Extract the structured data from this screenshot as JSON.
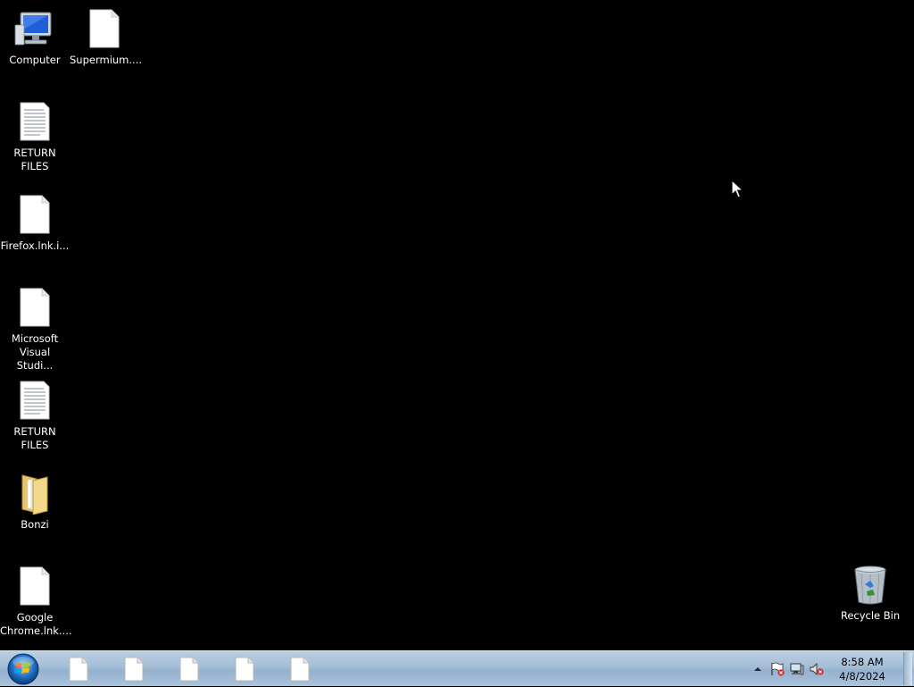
{
  "desktop": {
    "icons": [
      {
        "label": "Computer",
        "icon": "computer-icon"
      },
      {
        "label": "Supermium....",
        "icon": "file-icon"
      },
      {
        "label": "RETURN FILES",
        "icon": "text-document-icon"
      },
      {
        "label": "Firefox.lnk.i...",
        "icon": "file-icon"
      },
      {
        "label": "Microsoft\nVisual Studi...",
        "icon": "file-icon"
      },
      {
        "label": "RETURN FILES",
        "icon": "text-document-icon"
      },
      {
        "label": "Bonzi",
        "icon": "folder-icon"
      },
      {
        "label": "Google\nChrome.lnk....",
        "icon": "file-icon"
      },
      {
        "label": "Recycle Bin",
        "icon": "recycle-bin-icon"
      }
    ]
  },
  "taskbar": {
    "start_icon": "windows-orb-icon",
    "pinned": [
      {
        "icon": "file-icon"
      },
      {
        "icon": "file-icon"
      },
      {
        "icon": "file-icon"
      },
      {
        "icon": "file-icon"
      },
      {
        "icon": "file-icon"
      }
    ],
    "tray": {
      "icons": [
        "show-hidden-icons-arrow",
        "action-center-flag-icon",
        "network-icon",
        "volume-muted-icon"
      ],
      "time": "8:58 AM",
      "date": "4/8/2024"
    }
  },
  "colors": {
    "desktop_background": "#000000",
    "taskbar": "#a4bdd6",
    "label_text": "#ffffff"
  }
}
